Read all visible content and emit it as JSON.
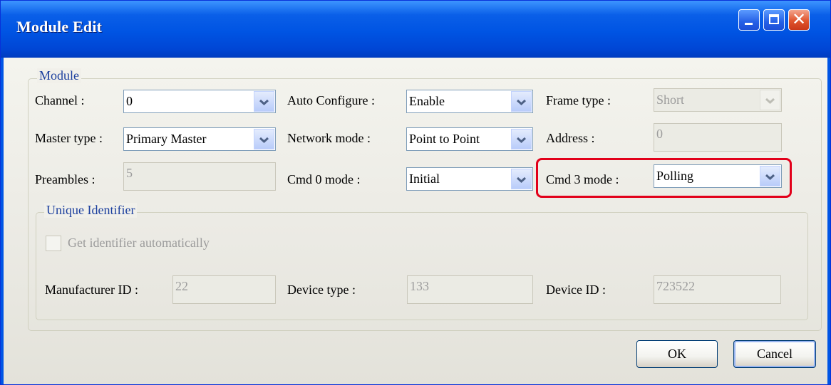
{
  "window": {
    "title": "Module Edit"
  },
  "module_group": {
    "title": "Module",
    "channel": {
      "label": "Channel :",
      "value": "0"
    },
    "auto_configure": {
      "label": "Auto Configure :",
      "value": "Enable"
    },
    "frame_type": {
      "label": "Frame type :",
      "value": "Short"
    },
    "master_type": {
      "label": "Master type :",
      "value": "Primary Master"
    },
    "network_mode": {
      "label": "Network mode :",
      "value": "Point to Point"
    },
    "address": {
      "label": "Address :",
      "value": "0"
    },
    "preambles": {
      "label": "Preambles :",
      "value": "5"
    },
    "cmd0_mode": {
      "label": "Cmd 0 mode :",
      "value": "Initial"
    },
    "cmd3_mode": {
      "label": "Cmd 3 mode :",
      "value": "Polling"
    }
  },
  "unique_identifier_group": {
    "title": "Unique Identifier",
    "get_identifier": {
      "label": "Get identifier automatically",
      "checked": false
    },
    "manufacturer_id": {
      "label": "Manufacturer ID :",
      "value": "22"
    },
    "device_type": {
      "label": "Device type :",
      "value": "133"
    },
    "device_id": {
      "label": "Device ID :",
      "value": "723522"
    }
  },
  "buttons": {
    "ok": "OK",
    "cancel": "Cancel"
  },
  "colors": {
    "titlebar": "#0054e3",
    "highlight_border": "#e2001a",
    "group_title": "#1b3f9e",
    "combo_arrow": "#4d6185"
  }
}
